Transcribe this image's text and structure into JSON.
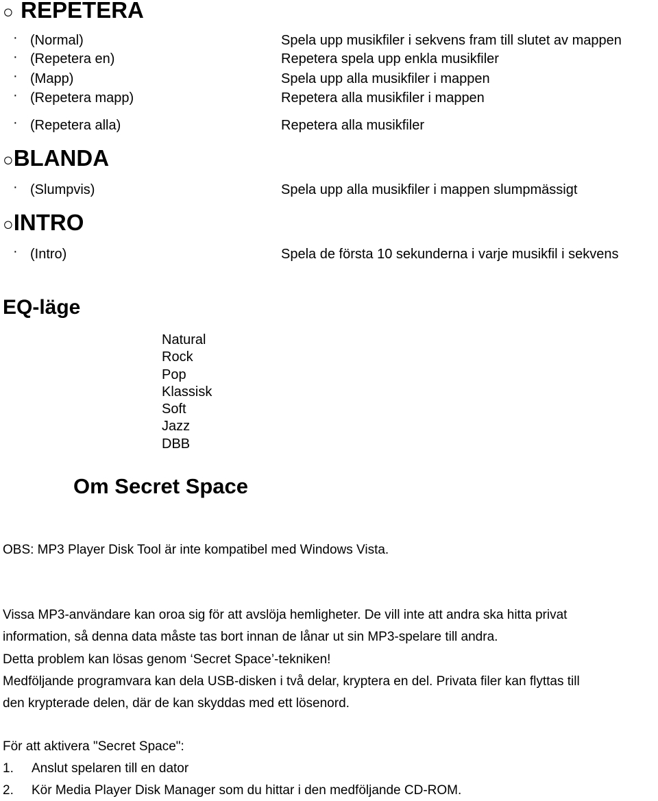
{
  "sections": [
    {
      "title": "REPETERA",
      "bullet": "○",
      "items": [
        {
          "mode": "(Normal)",
          "description": "Spela upp musikfiler i sekvens fram till slutet av mappen"
        },
        {
          "mode": "(Repetera en)",
          "description": "Repetera spela upp enkla musikfiler"
        },
        {
          "mode": "(Mapp)",
          "description": "Spela upp alla musikfiler i mappen"
        },
        {
          "mode": "(Repetera mapp)",
          "description": "Repetera alla musikfiler i mappen"
        },
        {
          "mode": "(Repetera alla)",
          "description": "Repetera alla musikfiler"
        }
      ]
    },
    {
      "title": "BLANDA",
      "bullet": "○",
      "items": [
        {
          "mode": "(Slumpvis)",
          "description": "Spela upp alla musikfiler i mappen slumpmässigt"
        }
      ]
    },
    {
      "title": "INTRO",
      "bullet": "○",
      "items": [
        {
          "mode": "(Intro)",
          "description": "Spela de första 10 sekunderna i varje musikfil i sekvens"
        }
      ]
    }
  ],
  "item_bullet": "·",
  "eq": {
    "title": "EQ-läge",
    "modes": [
      "Natural",
      "Rock",
      "Pop",
      "Klassisk",
      "Soft",
      "Jazz",
      "DBB"
    ]
  },
  "secret_space": {
    "title": "Om Secret Space",
    "note": "OBS: MP3 Player Disk Tool är inte kompatibel med Windows Vista.",
    "paragraph_lines": [
      "Vissa MP3-användare kan oroa sig för att avslöja hemligheter. De vill inte att andra ska hitta privat",
      "information, så denna data måste tas bort innan de lånar ut sin MP3-spelare till andra.",
      "Detta problem kan lösas genom ‘Secret Space’-tekniken!",
      "Medföljande programvara kan dela USB-disken i två delar, kryptera en del. Privata filer kan flyttas till",
      "den krypterade delen, där de kan skyddas med ett lösenord."
    ],
    "activate_title": "För att aktivera \"Secret Space\":",
    "steps": [
      {
        "num": "1.",
        "text": "Anslut spelaren till en dator"
      },
      {
        "num": "2.",
        "text": "Kör Media Player Disk Manager som du hittar i den medföljande CD-ROM."
      }
    ]
  }
}
